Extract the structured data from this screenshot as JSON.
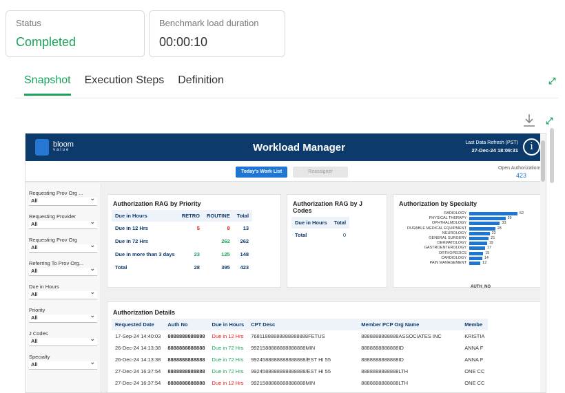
{
  "status_card": {
    "label": "Status",
    "value": "Completed",
    "value_color": "#1aa25a"
  },
  "benchmark_card": {
    "label": "Benchmark load duration",
    "value": "00:00:10"
  },
  "tabs": [
    {
      "label": "Snapshot",
      "active": true
    },
    {
      "label": "Execution Steps",
      "active": false
    },
    {
      "label": "Definition",
      "active": false
    }
  ],
  "report": {
    "logo": {
      "name": "bloom",
      "sub": "value"
    },
    "title": "Workload Manager",
    "refresh_label": "Last Data Refresh (PST)",
    "refresh_value": "27-Dec-24 18:09:31",
    "info_glyph": "i",
    "buttons": {
      "primary": "Today's Work List",
      "secondary": "Reassigner"
    },
    "open_auth": {
      "label": "Open Authorizations",
      "value": "423"
    },
    "filters": [
      {
        "label": "Requesting Prov Org ...",
        "value": "All"
      },
      {
        "label": "Requesting Provider",
        "value": "All"
      },
      {
        "label": "Requesting Prov Org",
        "value": "All"
      },
      {
        "label": "Referring To Prov Org...",
        "value": "All"
      },
      {
        "label": "Due in Hours",
        "value": "All"
      },
      {
        "label": "Priority",
        "value": "All"
      },
      {
        "label": "J Codes",
        "value": "All"
      },
      {
        "label": "Specialty",
        "value": "All"
      }
    ],
    "rag_priority": {
      "title": "Authorization RAG by Priority",
      "headers": [
        "Due in Hours",
        "RETRO",
        "ROUTINE",
        "Total"
      ],
      "rows": [
        [
          "Due in 12 Hrs",
          "5",
          "8",
          "13"
        ],
        [
          "Due in 72 Hrs",
          "",
          "262",
          "262"
        ],
        [
          "Due in more than 3 days",
          "23",
          "125",
          "148"
        ],
        [
          "Total",
          "28",
          "395",
          "423"
        ]
      ]
    },
    "rag_jcodes": {
      "title": "Authorization RAG by J Codes",
      "headers": [
        "Due in Hours",
        "Total"
      ],
      "rows": [
        [
          "Total",
          "0"
        ]
      ]
    },
    "specialty": {
      "title": "Authorization by Specialty",
      "axis_label": "AUTH_NO",
      "bar_color": "#1f76d2"
    },
    "details": {
      "title": "Authorization Details",
      "headers": [
        "Requested Date",
        "Auth No",
        "Due in Hours",
        "CPT Desc",
        "Member PCP Org Name",
        "Membe"
      ],
      "rows": [
        [
          "17-Sep-24 14:40:03",
          "8888888888888",
          "Due in 12 Hrs",
          "76811888888888888888FETUS",
          "8888888888888ASSOCIATES INC",
          "KRISTIA"
        ],
        [
          "26-Dec-24 14:13:38",
          "8888888888888",
          "Due in 72 Hrs",
          "9921588888888888888MIN",
          "8888888888888ID",
          "ANNA F"
        ],
        [
          "26-Dec-24 14:13:38",
          "8888888888888",
          "Due in 72 Hrs",
          "9924588888888888888/EST HI 55",
          "8888888888888ID",
          "ANNA F"
        ],
        [
          "27-Dec-24 16:37:54",
          "8888888888888",
          "Due in 72 Hrs",
          "9924588888888888888/EST HI 55",
          "8888888888888LTH",
          "ONE CC"
        ],
        [
          "27-Dec-24 16:37:54",
          "8888888888888",
          "Due in 12 Hrs",
          "9921588888888888888MIN",
          "8888888888888LTH",
          "ONE CC"
        ]
      ]
    }
  },
  "chart_data": {
    "type": "bar",
    "title": "Authorization by Specialty",
    "categories": [
      "RADIOLOGY",
      "PHYSICAL THERAPY",
      "OPHTHALMOLOGY",
      "DURABLE MEDICAL EQUIPMENT",
      "NEUROLOGY",
      "GENERAL SURGERY",
      "DERMATOLOGY",
      "GASTROENTEROLOGY",
      "ORTHOPEDICS",
      "CARDIOLOGY",
      "PAIN MANAGEMENT"
    ],
    "values": [
      52,
      39,
      33,
      28,
      22,
      21,
      19,
      17,
      15,
      14,
      12
    ],
    "xlabel": "AUTH_NO",
    "orientation": "horizontal"
  }
}
